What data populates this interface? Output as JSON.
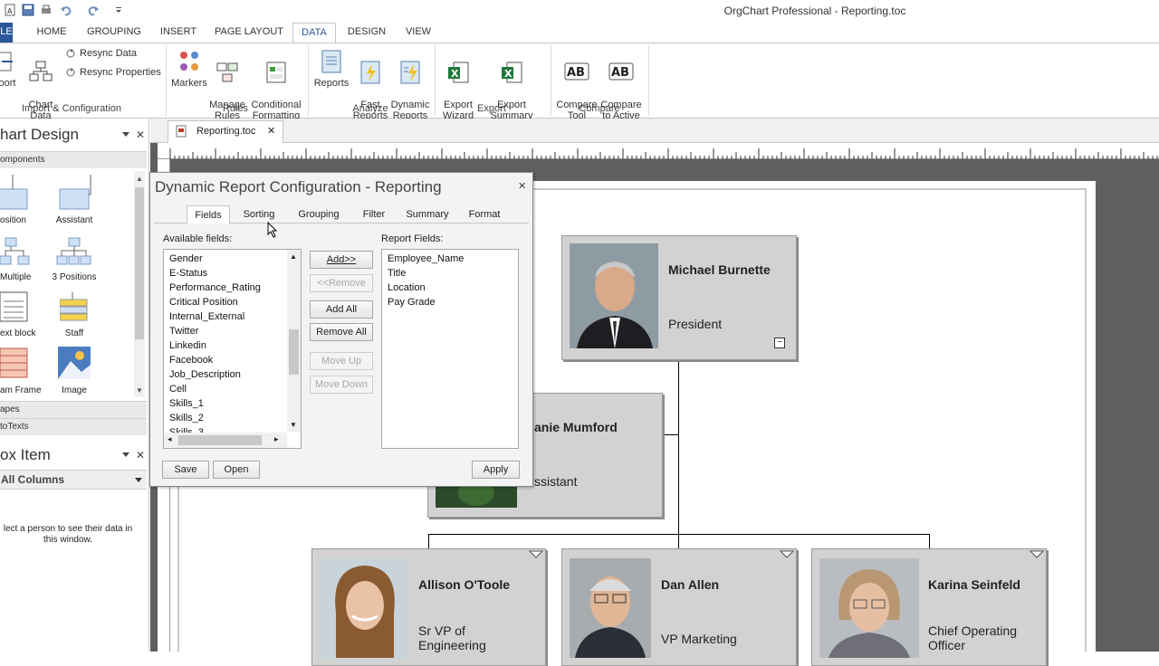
{
  "app": {
    "title": "OrgChart Professional - Reporting.toc"
  },
  "ribbon_tabs": [
    "LE",
    "HOME",
    "GROUPING",
    "INSERT",
    "PAGE LAYOUT",
    "DATA",
    "DESIGN",
    "VIEW"
  ],
  "ribbon": {
    "import_group": {
      "port_label": "oort",
      "chart_data_set": "Chart\nData Set",
      "resync_data": "Resync Data",
      "resync_properties": "Resync Properties",
      "label": "Import & Configuration"
    },
    "rules_group": {
      "markers": "Markers",
      "manage_rules": "Manage\nRules",
      "conditional_formatting": "Conditional\nFormatting",
      "label": "Rules"
    },
    "analyze_group": {
      "reports": "Reports",
      "fast_reports": "Fast\nReports",
      "dynamic_reports": "Dynamic\nReports",
      "label": "Analyze"
    },
    "export_group": {
      "export_wizard": "Export\nWizard",
      "export_summary_fields": "Export\nSummary Fields",
      "label": "Export"
    },
    "compare_group": {
      "compare_tool": "Compare\nTool",
      "compare_to_active": "Compare\nto Active",
      "label": "Compare"
    }
  },
  "left_panel": {
    "title": "hart Design",
    "components_label": "omponents",
    "shapes": [
      "osition",
      "Assistant",
      "Multiple",
      "3 Positions",
      "ext block",
      "Staff",
      "am Frame",
      "Image"
    ],
    "shapes_label": "apes",
    "autotexts_label": "toTexts",
    "box_item_title": "ox Item",
    "columns_select": "All Columns",
    "hint": "lect a person to see their data in\nthis window."
  },
  "document": {
    "tab_name": "Reporting.toc"
  },
  "dialog": {
    "title": "Dynamic Report Configuration - Reporting",
    "tabs": [
      "Fields",
      "Sorting",
      "Grouping",
      "Filter",
      "Summary",
      "Format"
    ],
    "available_fields_label": "Available fields:",
    "report_fields_label": "Report Fields:",
    "available_fields": [
      "Gender",
      "E-Status",
      "Performance_Rating",
      "Critical Position",
      "Internal_External",
      "Twitter",
      "Linkedin",
      "Facebook",
      "Job_Description",
      "Cell",
      "Skills_1",
      "Skills_2",
      "Skills_3"
    ],
    "report_fields": [
      "Employee_Name",
      "Title",
      "Location",
      "Pay Grade"
    ],
    "buttons": {
      "add": "Add>>",
      "remove": "<<Remove",
      "add_all": "Add All",
      "remove_all": "Remove All",
      "move_up": "Move Up",
      "move_down": "Move Down",
      "save": "Save",
      "open": "Open",
      "apply": "Apply"
    }
  },
  "org_chart": {
    "people": [
      {
        "name": "Michael Burnette",
        "title": "President"
      },
      {
        "name": "anie Mumford",
        "title": "ssistant"
      },
      {
        "name": "Allison O'Toole",
        "title": "Sr VP of\nEngineering"
      },
      {
        "name": "Dan Allen",
        "title": "VP Marketing"
      },
      {
        "name": "Karina Seinfeld",
        "title": "Chief Operating\nOfficer"
      }
    ]
  },
  "colors": {
    "accent": "#2b579a",
    "box_fill": "#d2d2d2",
    "canvas_bg": "#5f5f5f"
  }
}
